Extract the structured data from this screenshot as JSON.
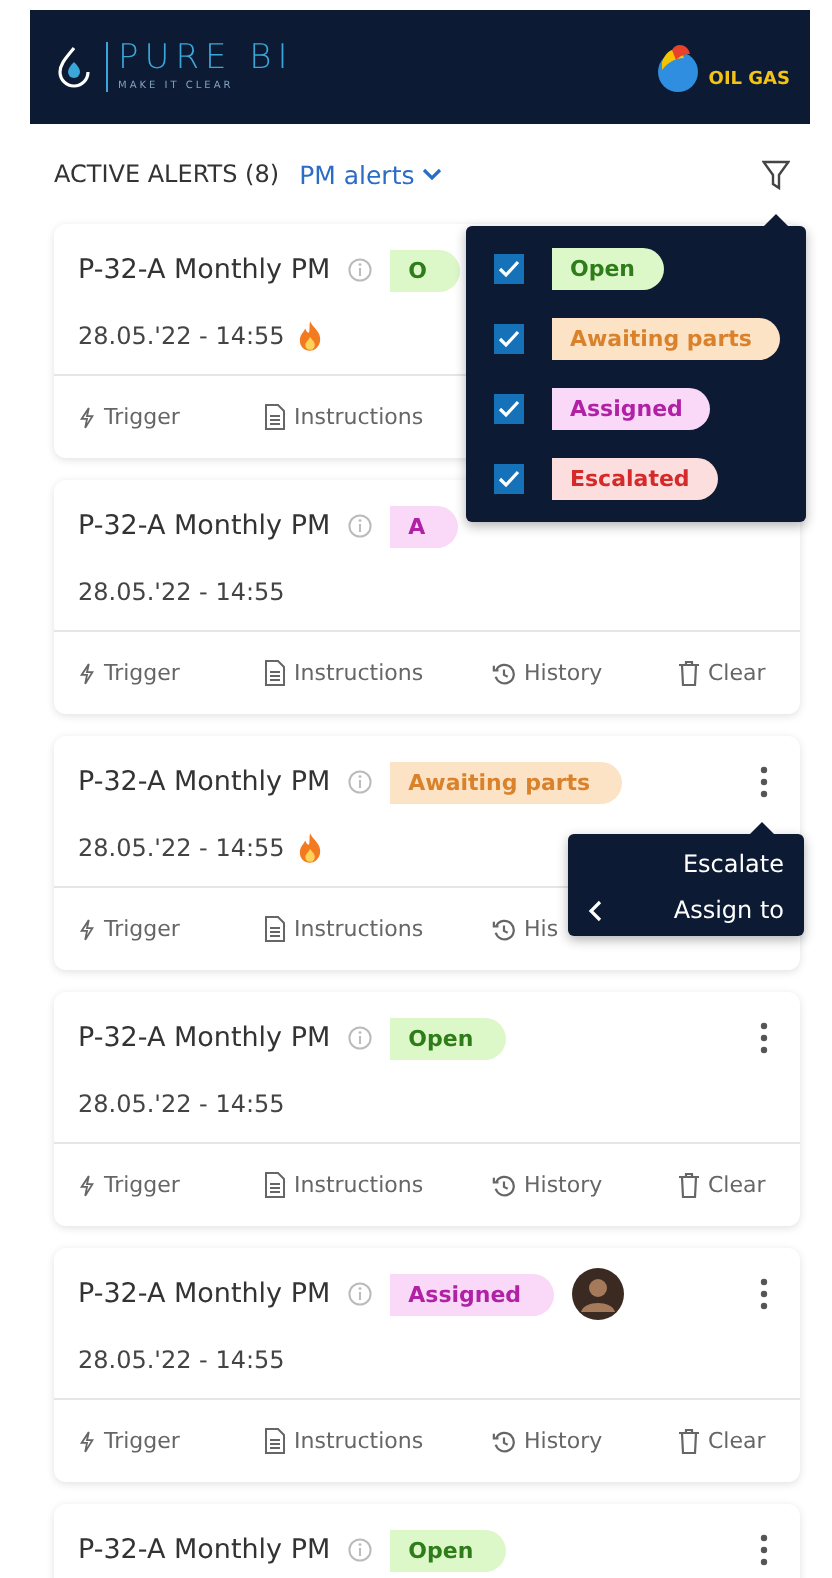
{
  "header": {
    "brand": "PURE BI",
    "tagline": "MAKE IT CLEAR",
    "partner": "OIL GAS"
  },
  "toolbar": {
    "title": "ACTIVE ALERTS (8)",
    "view": "PM alerts"
  },
  "cards": [
    {
      "title": "P-32-A Monthly PM",
      "status": {
        "label": "O",
        "kind": "open"
      },
      "date": "28.05.'22 - 14:55",
      "hot": true,
      "avatar": false,
      "menu": false,
      "actions": [
        {
          "kind": "trigger",
          "label": "Trigger"
        },
        {
          "kind": "instructions",
          "label": "Instructions"
        }
      ]
    },
    {
      "title": "P-32-A Monthly PM",
      "status": {
        "label": "A",
        "kind": "assigned"
      },
      "date": "28.05.'22 - 14:55",
      "hot": false,
      "avatar": false,
      "menu": false,
      "actions": [
        {
          "kind": "trigger",
          "label": "Trigger"
        },
        {
          "kind": "instructions",
          "label": "Instructions"
        },
        {
          "kind": "history",
          "label": "History"
        },
        {
          "kind": "clear",
          "label": "Clear"
        }
      ]
    },
    {
      "title": "P-32-A Monthly PM",
      "status": {
        "label": "Awaiting parts",
        "kind": "awaiting"
      },
      "date": "28.05.'22 - 14:55",
      "hot": true,
      "avatar": false,
      "menu": true,
      "actions": [
        {
          "kind": "trigger",
          "label": "Trigger"
        },
        {
          "kind": "instructions",
          "label": "Instructions"
        },
        {
          "kind": "history",
          "label": "His"
        }
      ]
    },
    {
      "title": "P-32-A Monthly PM",
      "status": {
        "label": "Open",
        "kind": "open"
      },
      "date": "28.05.'22 - 14:55",
      "hot": false,
      "avatar": false,
      "menu": true,
      "actions": [
        {
          "kind": "trigger",
          "label": "Trigger"
        },
        {
          "kind": "instructions",
          "label": "Instructions"
        },
        {
          "kind": "history",
          "label": "History"
        },
        {
          "kind": "clear",
          "label": "Clear"
        }
      ]
    },
    {
      "title": "P-32-A Monthly PM",
      "status": {
        "label": "Assigned",
        "kind": "assigned"
      },
      "date": "28.05.'22 - 14:55",
      "hot": false,
      "avatar": true,
      "menu": true,
      "actions": [
        {
          "kind": "trigger",
          "label": "Trigger"
        },
        {
          "kind": "instructions",
          "label": "Instructions"
        },
        {
          "kind": "history",
          "label": "History"
        },
        {
          "kind": "clear",
          "label": "Clear"
        }
      ]
    },
    {
      "title": "P-32-A Monthly PM",
      "status": {
        "label": "Open",
        "kind": "open"
      },
      "menu": true
    }
  ],
  "filter_menu": {
    "options": [
      {
        "label": "Open",
        "kind": "open",
        "checked": true
      },
      {
        "label": "Awaiting parts",
        "kind": "awaiting",
        "checked": true
      },
      {
        "label": "Assigned",
        "kind": "assigned",
        "checked": true
      },
      {
        "label": "Escalated",
        "kind": "escalated",
        "checked": true
      }
    ]
  },
  "action_menu": {
    "items": [
      {
        "label": "Escalate",
        "submenu": false
      },
      {
        "label": "Assign to",
        "submenu": true
      }
    ]
  }
}
